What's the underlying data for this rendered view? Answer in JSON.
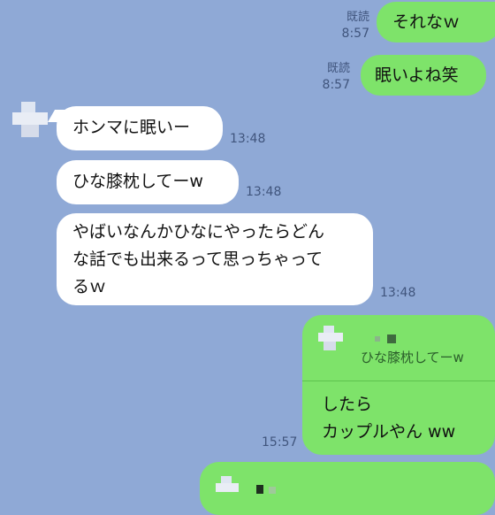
{
  "messages": [
    {
      "text": "それなｗ",
      "read_label": "既読",
      "time": "8:57"
    },
    {
      "text": "眠いよね笑",
      "read_label": "既読",
      "time": "8:57"
    },
    {
      "text": "ホンマに眠いー",
      "time": "13:48"
    },
    {
      "text": "ひな膝枕してーw",
      "time": "13:48"
    },
    {
      "lines": [
        "やばいなんかひなにやったらどん",
        "な話でも出来るって思っちゃって",
        "るｗ"
      ],
      "time": "13:48"
    },
    {
      "reply": {
        "quoted_text": "ひな膝枕してーw"
      },
      "lines": [
        "したら",
        "カップルやん ww"
      ],
      "time": "15:57"
    }
  ],
  "colors": {
    "background": "#8fa9d6",
    "outgoing": "#7ee36a",
    "incoming": "#ffffff"
  }
}
